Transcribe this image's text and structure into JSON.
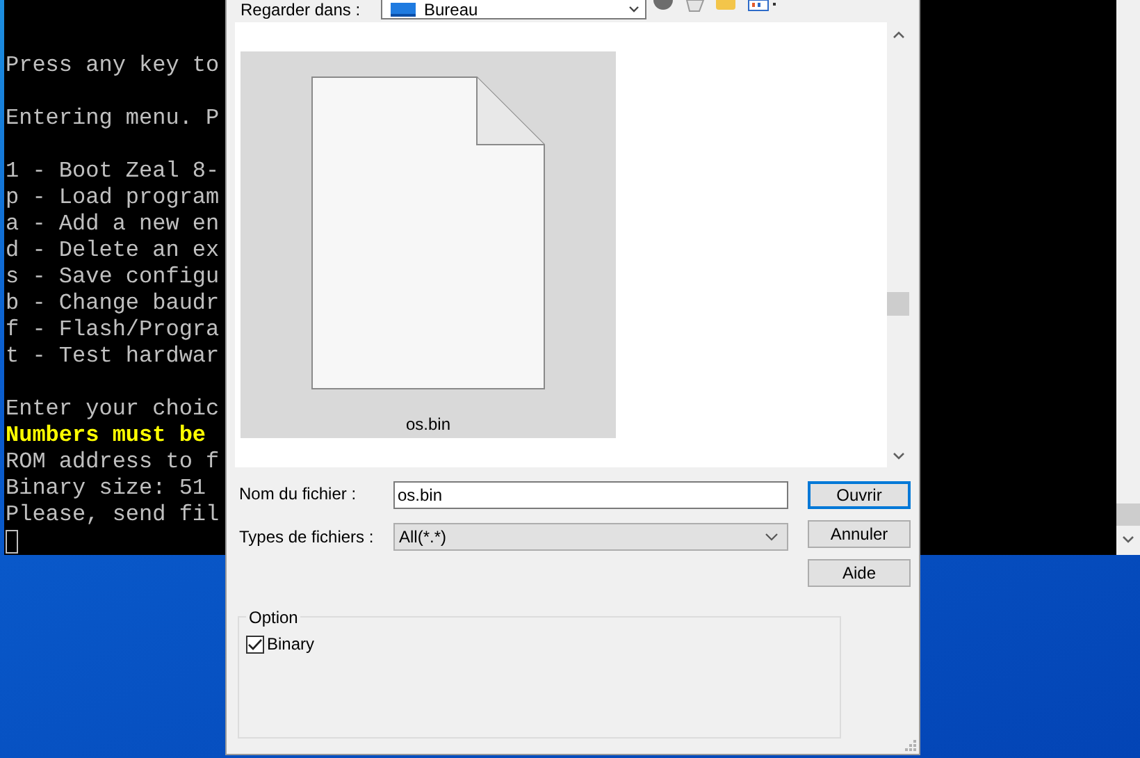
{
  "terminal": {
    "blocks": [
      [
        {
          "text": "Press any key to",
          "kind": "normal"
        }
      ],
      [
        {
          "text": "Entering menu. P",
          "kind": "normal"
        }
      ],
      [
        {
          "text": "1 - Boot Zeal 8-",
          "kind": "normal"
        },
        {
          "text": "p - Load program",
          "kind": "normal"
        },
        {
          "text": "a - Add a new en",
          "kind": "normal"
        },
        {
          "text": "d - Delete an ex",
          "kind": "normal"
        },
        {
          "text": "s - Save configu",
          "kind": "normal"
        },
        {
          "text": "b - Change baudr",
          "kind": "normal"
        },
        {
          "text": "f - Flash/Progra",
          "kind": "normal"
        },
        {
          "text": "t - Test hardwar",
          "kind": "normal"
        }
      ],
      [
        {
          "text": "Enter your choic",
          "kind": "normal"
        },
        {
          "text": "Numbers must be",
          "kind": "warning"
        },
        {
          "text": "ROM address to f",
          "kind": "normal"
        },
        {
          "text": "Binary size: 51",
          "kind": "normal"
        },
        {
          "text": "Please, send fil",
          "kind": "normal"
        }
      ]
    ]
  },
  "dialog": {
    "look_in_label": "Regarder dans :",
    "look_in_value": "Bureau",
    "files": [
      {
        "name": "os.bin",
        "selected": true
      }
    ],
    "filename_label": "Nom du fichier :",
    "filename_value": "os.bin",
    "filetype_label": "Types de fichiers :",
    "filetype_value": "All(*.*)",
    "buttons": [
      {
        "label": "Ouvrir",
        "default": true
      },
      {
        "label": "Annuler",
        "default": false
      },
      {
        "label": "Aide",
        "default": false
      }
    ],
    "option_group": {
      "title": "Option",
      "checkbox": {
        "label": "Binary",
        "checked": true
      }
    }
  }
}
